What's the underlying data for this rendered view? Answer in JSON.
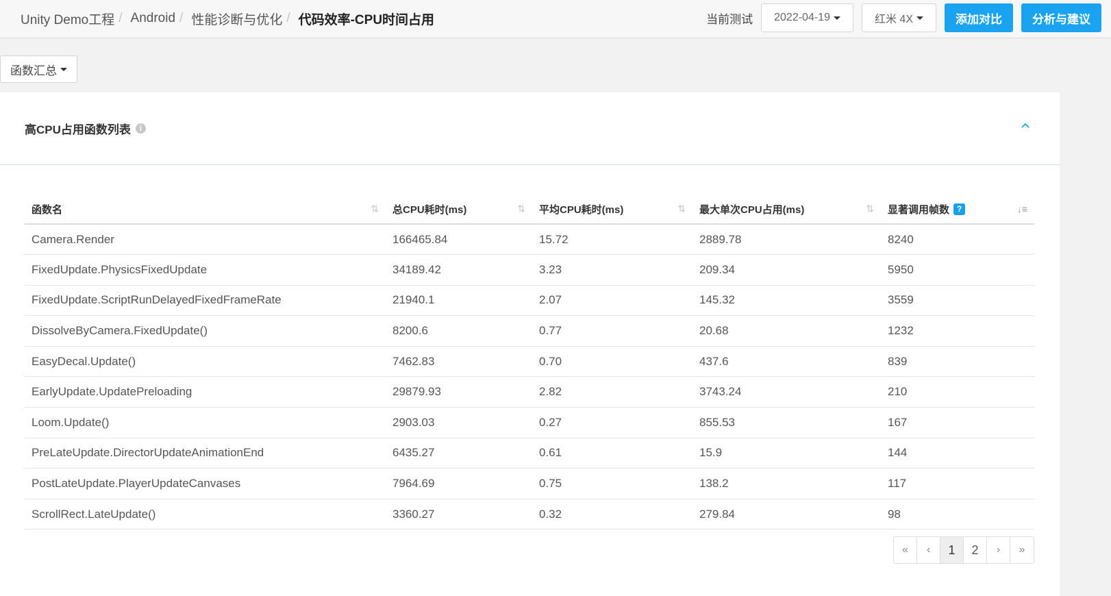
{
  "breadcrumb": {
    "items": [
      "Unity Demo工程",
      "Android",
      "性能诊断与优化"
    ],
    "current": "代码效率-CPU时间占用"
  },
  "header": {
    "test_label": "当前测试",
    "date_value": "2022-04-19",
    "device_value": "红米 4X",
    "add_compare_label": "添加对比",
    "analysis_label": "分析与建议"
  },
  "filter": {
    "summary_label": "函数汇总"
  },
  "panel": {
    "title": "高CPU占用函数列表"
  },
  "table": {
    "headers": {
      "name": "函数名",
      "total_cpu": "总CPU耗时(ms)",
      "avg_cpu": "平均CPU耗时(ms)",
      "max_cpu": "最大单次CPU占用(ms)",
      "frames": "显著调用帧数"
    },
    "rows": [
      {
        "name": "Camera.Render",
        "total": "166465.84",
        "avg": "15.72",
        "max": "2889.78",
        "frames": "8240"
      },
      {
        "name": "FixedUpdate.PhysicsFixedUpdate",
        "total": "34189.42",
        "avg": "3.23",
        "max": "209.34",
        "frames": "5950"
      },
      {
        "name": "FixedUpdate.ScriptRunDelayedFixedFrameRate",
        "total": "21940.1",
        "avg": "2.07",
        "max": "145.32",
        "frames": "3559"
      },
      {
        "name": "DissolveByCamera.FixedUpdate()",
        "total": "8200.6",
        "avg": "0.77",
        "max": "20.68",
        "frames": "1232"
      },
      {
        "name": "EasyDecal.Update()",
        "total": "7462.83",
        "avg": "0.70",
        "max": "437.6",
        "frames": "839"
      },
      {
        "name": "EarlyUpdate.UpdatePreloading",
        "total": "29879.93",
        "avg": "2.82",
        "max": "3743.24",
        "frames": "210"
      },
      {
        "name": "Loom.Update()",
        "total": "2903.03",
        "avg": "0.27",
        "max": "855.53",
        "frames": "167"
      },
      {
        "name": "PreLateUpdate.DirectorUpdateAnimationEnd",
        "total": "6435.27",
        "avg": "0.61",
        "max": "15.9",
        "frames": "144"
      },
      {
        "name": "PostLateUpdate.PlayerUpdateCanvases",
        "total": "7964.69",
        "avg": "0.75",
        "max": "138.2",
        "frames": "117"
      },
      {
        "name": "ScrollRect.LateUpdate()",
        "total": "3360.27",
        "avg": "0.32",
        "max": "279.84",
        "frames": "98"
      }
    ]
  },
  "pagination": {
    "first": "«",
    "prev": "‹",
    "pages": [
      "1",
      "2"
    ],
    "current": "1",
    "next": "›",
    "last": "»"
  },
  "colors": {
    "primary": "#1aa3f0",
    "link": "#3d73b0",
    "page_bg": "#f2f2f2"
  }
}
